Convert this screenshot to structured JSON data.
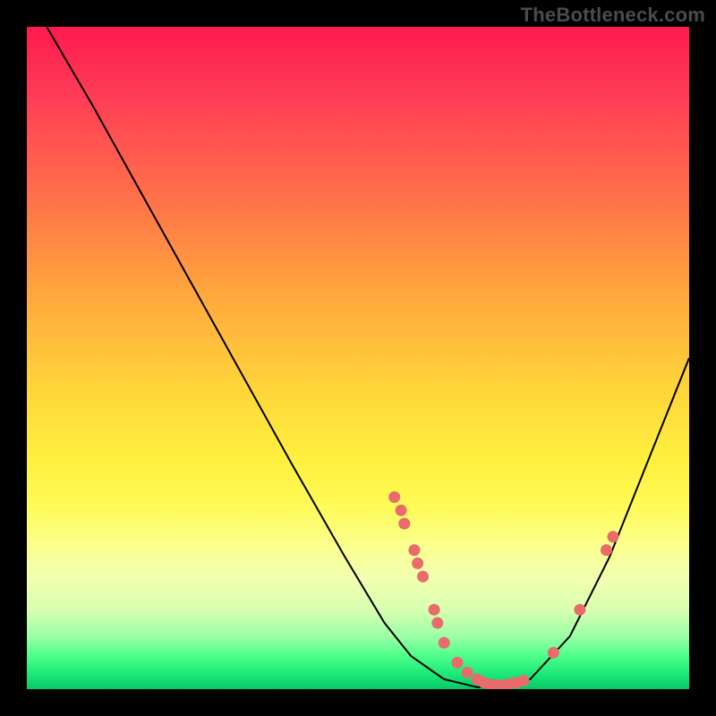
{
  "watermark": "TheBottleneck.com",
  "chart_data": {
    "type": "line",
    "title": "",
    "xlabel": "",
    "ylabel": "",
    "xlim": [
      0,
      100
    ],
    "ylim": [
      0,
      100
    ],
    "background": "vertical-gradient red→green",
    "series": [
      {
        "name": "bottleneck-curve",
        "style": "black-line",
        "points": [
          {
            "x": 3,
            "y": 100
          },
          {
            "x": 10,
            "y": 88
          },
          {
            "x": 20,
            "y": 70
          },
          {
            "x": 30,
            "y": 52
          },
          {
            "x": 40,
            "y": 34
          },
          {
            "x": 48,
            "y": 20
          },
          {
            "x": 54,
            "y": 10
          },
          {
            "x": 58,
            "y": 5
          },
          {
            "x": 63,
            "y": 1.5
          },
          {
            "x": 68,
            "y": 0.3
          },
          {
            "x": 72,
            "y": 0.3
          },
          {
            "x": 76,
            "y": 1.5
          },
          {
            "x": 82,
            "y": 8
          },
          {
            "x": 88,
            "y": 20
          },
          {
            "x": 94,
            "y": 35
          },
          {
            "x": 100,
            "y": 50
          }
        ]
      },
      {
        "name": "highlight-dots",
        "style": "salmon-dot",
        "points": [
          {
            "x": 55.5,
            "y": 29
          },
          {
            "x": 56.5,
            "y": 27
          },
          {
            "x": 57.0,
            "y": 25
          },
          {
            "x": 58.5,
            "y": 21
          },
          {
            "x": 59.0,
            "y": 19
          },
          {
            "x": 59.8,
            "y": 17
          },
          {
            "x": 61.5,
            "y": 12
          },
          {
            "x": 62.0,
            "y": 10
          },
          {
            "x": 63.0,
            "y": 7
          },
          {
            "x": 65.0,
            "y": 4
          },
          {
            "x": 66.5,
            "y": 2.5
          },
          {
            "x": 68.0,
            "y": 1.5
          },
          {
            "x": 69.0,
            "y": 1.0
          },
          {
            "x": 70.0,
            "y": 0.7
          },
          {
            "x": 71.0,
            "y": 0.6
          },
          {
            "x": 72.0,
            "y": 0.6
          },
          {
            "x": 73.0,
            "y": 0.8
          },
          {
            "x": 74.0,
            "y": 1.0
          },
          {
            "x": 75.0,
            "y": 1.3
          },
          {
            "x": 79.5,
            "y": 5.5
          },
          {
            "x": 83.5,
            "y": 12
          },
          {
            "x": 87.5,
            "y": 21
          },
          {
            "x": 88.5,
            "y": 23
          }
        ]
      }
    ]
  }
}
